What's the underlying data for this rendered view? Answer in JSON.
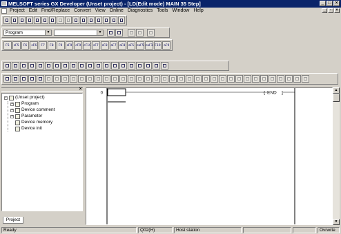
{
  "window": {
    "title": "MELSOFT series GX Developer (Unset project) - [LD(Edit mode)     MAIN     35 Step]"
  },
  "menu": [
    "Project",
    "Edit",
    "Find/Replace",
    "Convert",
    "View",
    "Online",
    "Diagnostics",
    "Tools",
    "Window",
    "Help"
  ],
  "toolbar": {
    "data_type_combo": "Program",
    "device_combo": "",
    "ladder_keys": [
      "F5",
      "sF5",
      "F6",
      "sF6",
      "F7",
      "F8",
      "F9",
      "sF9",
      "cF9",
      "cF10",
      "sF7",
      "sF8",
      "aF7",
      "aF8",
      "aF5",
      "caF5",
      "caF10",
      "F10",
      "aF9"
    ]
  },
  "tree": {
    "root": "(Unset project)",
    "items": [
      "Program",
      "Device comment",
      "Parameter",
      "Device memory",
      "Device init"
    ]
  },
  "panel": {
    "tab": "Project"
  },
  "ladder": {
    "step_number": "0",
    "end_label": "END"
  },
  "statusbar": {
    "ready": "Ready",
    "cpu": "Q02(H)",
    "station": "Host station",
    "mode": "Ovrwrte"
  }
}
